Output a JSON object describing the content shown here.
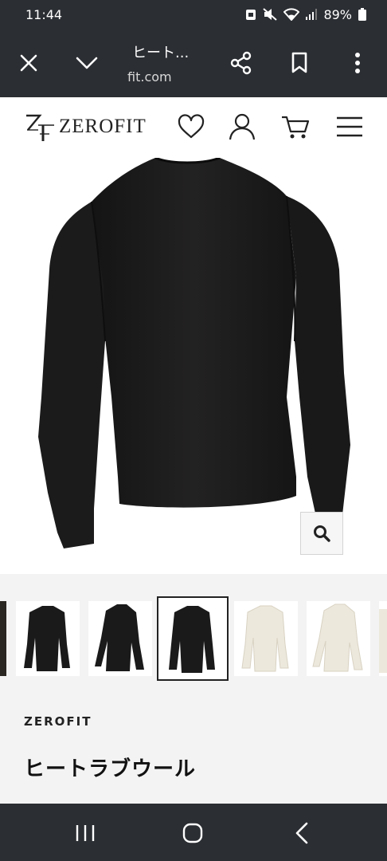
{
  "status_bar": {
    "time": "11:44",
    "battery": "89%"
  },
  "browser": {
    "title": "ヒート...",
    "url": "fit.com"
  },
  "site": {
    "logo_text": "ZEROFIT"
  },
  "product": {
    "brand": "ZEROFIT",
    "name": "ヒートラブウール"
  },
  "thumbnails": [
    {
      "color": "black",
      "view": "partial"
    },
    {
      "color": "black",
      "view": "front"
    },
    {
      "color": "black",
      "view": "side"
    },
    {
      "color": "black",
      "view": "back",
      "selected": true
    },
    {
      "color": "white",
      "view": "front"
    },
    {
      "color": "white",
      "view": "side"
    },
    {
      "color": "white",
      "view": "partial"
    }
  ],
  "colors": {
    "system_bar": "#2b2e33",
    "panel": "#f3f3f3",
    "garment_dark": "#1c1b1b",
    "garment_light": "#ece8dc"
  }
}
